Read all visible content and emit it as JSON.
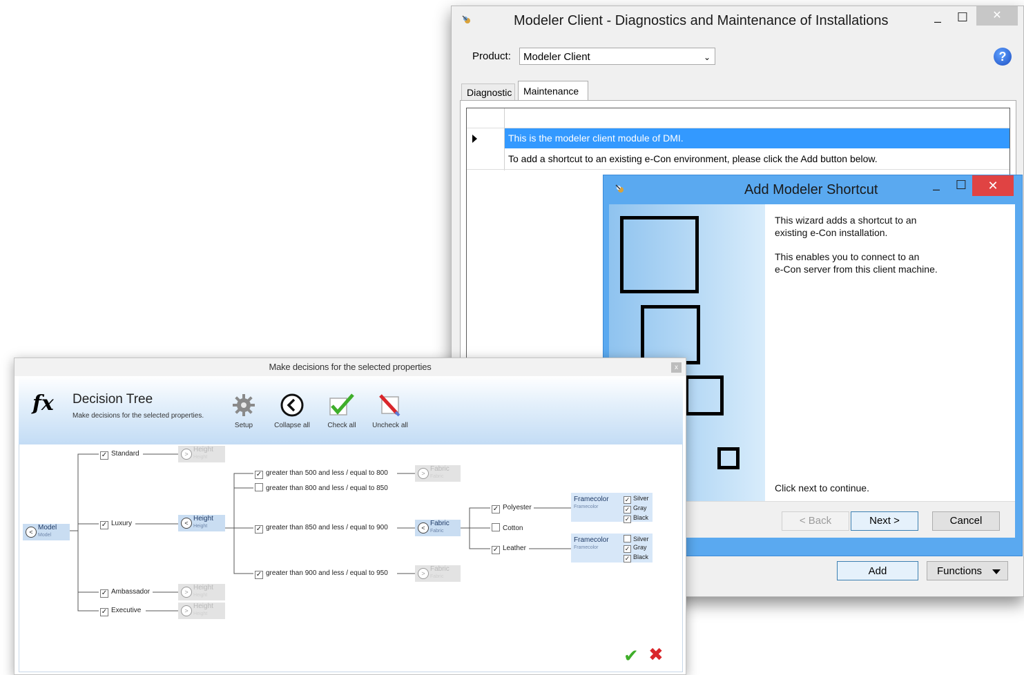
{
  "main_window": {
    "title": "Modeler Client - Diagnostics and Maintenance of Installations",
    "minimize": "–",
    "maximize": "☐",
    "close": "✕",
    "product_label": "Product:",
    "product_value": "Modeler Client",
    "help": "?",
    "tabs": [
      {
        "label": "Diagnostic",
        "selected": false
      },
      {
        "label": "Maintenance",
        "selected": true
      }
    ],
    "rows": [
      {
        "text": "This is the modeler client module of DMI.",
        "selected": true
      },
      {
        "text": "To add a shortcut to an existing e-Con environment, please click the Add button below.",
        "selected": false
      }
    ],
    "add_button": "Add",
    "functions_button": "Functions"
  },
  "wizard": {
    "title": "Add Modeler Shortcut",
    "minimize": "–",
    "maximize": "☐",
    "close": "✕",
    "para1_line1": "This wizard adds a shortcut to an",
    "para1_line2": "existing e-Con installation.",
    "para2_line1": "This enables you to connect to an",
    "para2_line2": "e-Con server from this client machine.",
    "continue_text": "Click next to continue.",
    "back_button": "< Back",
    "next_button": "Next >",
    "cancel_button": "Cancel"
  },
  "decision_dialog": {
    "window_title": "Make decisions for the selected properties",
    "close": "x",
    "title": "Decision Tree",
    "subtitle": "Make decisions for the selected properties.",
    "ribbon": {
      "setup": "Setup",
      "collapse_all": "Collapse all",
      "check_all": "Check all",
      "uncheck_all": "Uncheck all"
    },
    "tree": {
      "root": {
        "label": "Model",
        "sub": "Model"
      },
      "models": [
        {
          "label": "Standard",
          "checked": true
        },
        {
          "label": "Luxury",
          "checked": true
        },
        {
          "label": "Ambassador",
          "checked": true
        },
        {
          "label": "Executive",
          "checked": true
        }
      ],
      "height_pill": {
        "label": "Height",
        "sub": "Height"
      },
      "heights": [
        {
          "label": "greater than 500 and less / equal to 800",
          "checked": true
        },
        {
          "label": "greater than 800 and less / equal to 850",
          "checked": false
        },
        {
          "label": "greater than 850 and less / equal to 900",
          "checked": true
        },
        {
          "label": "greater than 900 and less / equal to 950",
          "checked": true
        }
      ],
      "fabric_pill": {
        "label": "Fabric",
        "sub": "Fabric"
      },
      "fabrics": [
        {
          "label": "Polyester",
          "checked": true
        },
        {
          "label": "Cotton",
          "checked": false
        },
        {
          "label": "Leather",
          "checked": true
        }
      ],
      "framecolor": {
        "label": "Framecolor",
        "sub": "Framecolor"
      },
      "colors_polyester": [
        {
          "label": "Silver",
          "checked": true
        },
        {
          "label": "Gray",
          "checked": true
        },
        {
          "label": "Black",
          "checked": true
        }
      ],
      "colors_leather": [
        {
          "label": "Silver",
          "checked": false
        },
        {
          "label": "Gray",
          "checked": true
        },
        {
          "label": "Black",
          "checked": true
        }
      ]
    },
    "ok_symbol": "✔",
    "cancel_symbol": "✖"
  },
  "colors": {
    "selection": "#3399ff",
    "wizard_frame": "#5aa9f0",
    "close_red": "#e04343",
    "ok_green": "#3fae2a",
    "cancel_red": "#d9262b"
  }
}
